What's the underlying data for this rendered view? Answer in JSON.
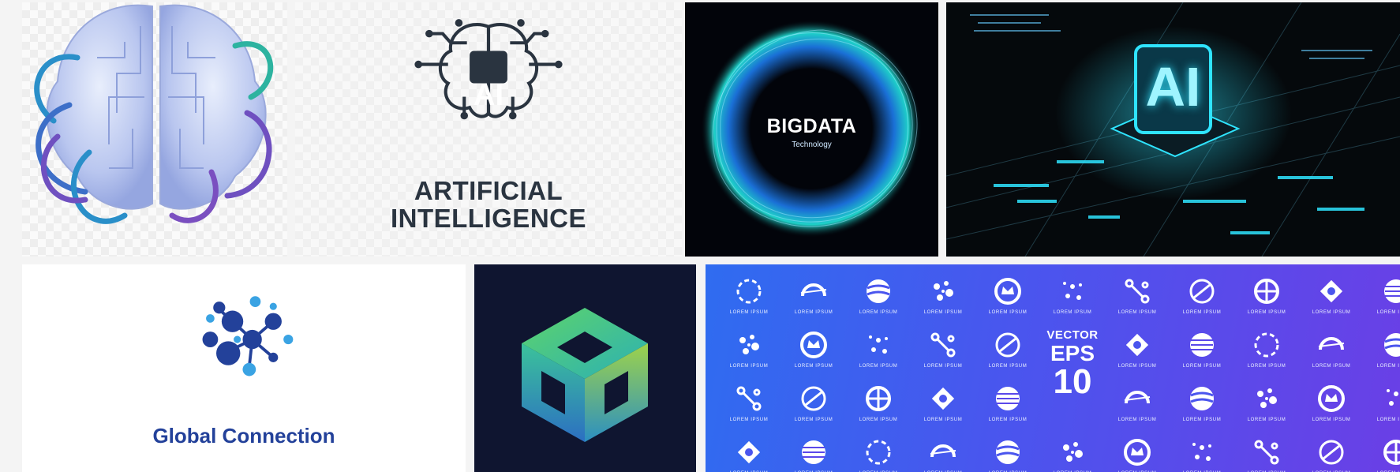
{
  "tiles": {
    "brain_circuit": {
      "icon": "brain-circuit-3d"
    },
    "ai_logo": {
      "badge": "AI",
      "caption_line1": "ARTIFICIAL",
      "caption_line2": "INTELLIGENCE"
    },
    "bigdata": {
      "title": "BIGDATA",
      "subtitle": "Technology"
    },
    "ai_chip": {
      "badge": "AI"
    },
    "global_connection": {
      "title": "Global Connection"
    },
    "cube_logo": {
      "icon": "isometric-cube-logo"
    },
    "logo_set": {
      "cell_label": "LOREM IPSUM",
      "vector_line1": "VECTOR",
      "vector_line2": "EPS",
      "vector_line3": "10"
    }
  },
  "colors": {
    "ai_text": "#2a3440",
    "bigdata_glow": "#1fd1c8",
    "chip_cyan": "#2fe4ff",
    "global_blue": "#23419a",
    "logo_set_gradient_start": "#2f6cf0",
    "logo_set_gradient_end": "#6a3fe6"
  }
}
